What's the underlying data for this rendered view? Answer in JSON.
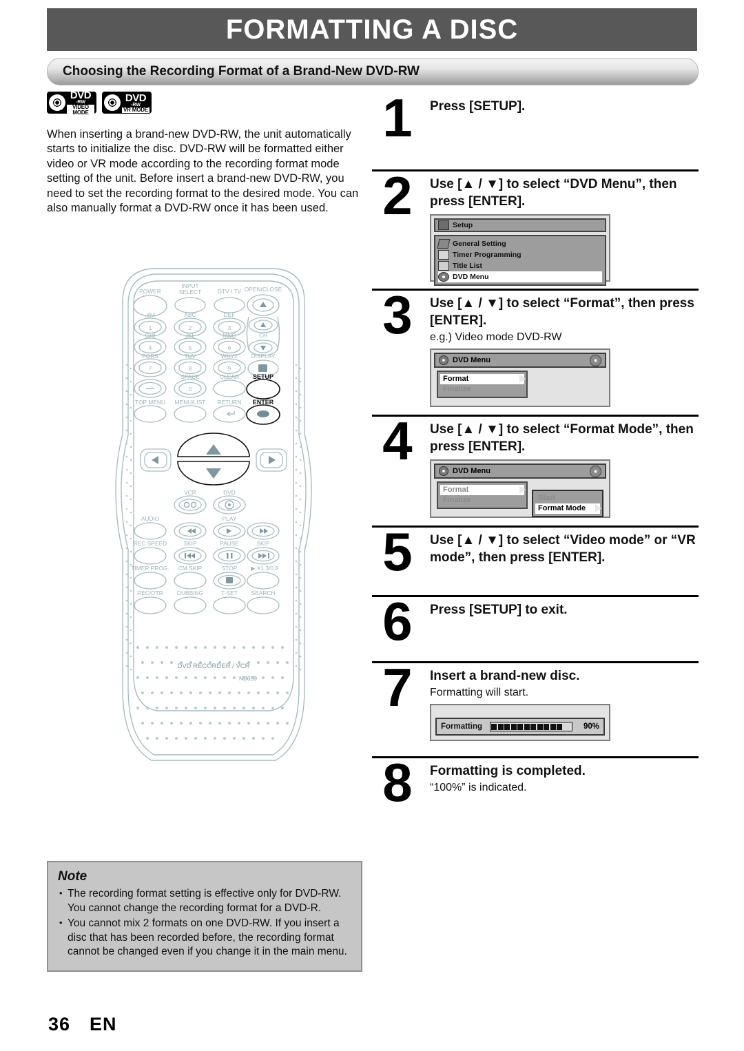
{
  "header": {
    "title": "FORMATTING A DISC",
    "subtitle": "Choosing the Recording Format of a Brand-New DVD-RW"
  },
  "logos": [
    {
      "name": "dvd-rw-video-mode-logo",
      "line1": "DVD",
      "line2": "-RW",
      "line3": "VIDEO MODE"
    },
    {
      "name": "dvd-rw-vr-mode-logo",
      "line1": "DVD",
      "line2": "-RW",
      "line3": "VR MODE"
    }
  ],
  "intro": "When inserting a brand-new DVD-RW, the unit automatically starts to initialize the disc. DVD-RW will be formatted either video or VR mode according to the recording format mode setting of the unit. Before insert a brand-new DVD-RW, you need to set the recording format to the desired mode. You can also manually format a DVD-RW once it has been used.",
  "steps": [
    {
      "number": "1",
      "heading": "Press [SETUP].",
      "sub": ""
    },
    {
      "number": "2",
      "heading": "Use [▲ / ▼] to select “DVD Menu”, then press [ENTER].",
      "sub": ""
    },
    {
      "number": "3",
      "heading": "Use [▲ / ▼] to select “Format”, then press [ENTER].",
      "sub": "e.g.) Video mode DVD-RW"
    },
    {
      "number": "4",
      "heading": "Use [▲ / ▼] to select “Format Mode”, then press [ENTER].",
      "sub": ""
    },
    {
      "number": "5",
      "heading": "Use [▲ / ▼] to select “Video mode” or “VR mode”, then press [ENTER].",
      "sub": ""
    },
    {
      "number": "6",
      "heading": "Press [SETUP] to exit.",
      "sub": ""
    },
    {
      "number": "7",
      "heading": "Insert a brand-new disc.",
      "sub": "Formatting will start."
    },
    {
      "number": "8",
      "heading": "Formatting is completed.",
      "sub": "“100%” is indicated."
    }
  ],
  "osd_setup": {
    "title": "Setup",
    "items": [
      {
        "label": "General Setting",
        "selected": false,
        "icon": "wrench-icon"
      },
      {
        "label": "Timer Programming",
        "selected": false,
        "icon": "grid-icon"
      },
      {
        "label": "Title List",
        "selected": false,
        "icon": "list-icon"
      },
      {
        "label": "DVD Menu",
        "selected": true,
        "icon": "disc-icon"
      }
    ]
  },
  "osd_dvdmenu_step3": {
    "title": "DVD Menu",
    "items": [
      {
        "label": "Format",
        "selected": true
      },
      {
        "label": "Finalize",
        "selected": false
      }
    ]
  },
  "osd_dvdmenu_step4": {
    "title": "DVD Menu",
    "items": [
      {
        "label": "Format",
        "selected": false
      },
      {
        "label": "Finalize",
        "selected": false
      }
    ],
    "submenu": [
      {
        "label": "Start",
        "selected": false
      },
      {
        "label": "Format Mode",
        "selected": true
      }
    ]
  },
  "osd_formatting": {
    "label": "Formatting",
    "percent": "90%",
    "segments": 11
  },
  "note": {
    "title": "Note",
    "items": [
      "The recording format setting is effective only for DVD-RW. You cannot change the recording format for a DVD-R.",
      "You cannot mix 2 formats on one DVD-RW. If you insert a disc that has been recorded before, the recording format cannot be changed even if you change it in the main menu."
    ]
  },
  "remote": {
    "model_label": "DVD RECORDER / VCR",
    "model_number": "NB659",
    "labels": {
      "power": "POWER",
      "input_select": "INPUT\nSELECT",
      "dtv_tv": "DTV / TV",
      "open_close": "OPEN/CLOSE",
      "k1_sup": ".@/:",
      "k2_sup": "ABC",
      "k3_sup": "DEF",
      "k4_sup": "GHI",
      "k5_sup": "JKL",
      "k6_sup": "MNO",
      "k7_sup": "PQRS",
      "k8_sup": "TUV",
      "k9_sup": "WXYZ",
      "k0_sup": "SPACE",
      "clear": "CLEAR",
      "display": "DISPLAY",
      "ch": "CH",
      "setup": "SETUP",
      "enter": "ENTER",
      "top_menu": "TOP MENU",
      "menu_list": "MENU/LIST",
      "return": "RETURN",
      "vcr": "VCR",
      "dvd": "DVD",
      "audio": "AUDIO",
      "play": "PLAY",
      "rec_speed": "REC SPEED",
      "skip_left": "SKIP",
      "pause": "PAUSE",
      "skip_right": "SKIP",
      "timer_prog": "TIMER PROG.",
      "cm_skip": "CM SKIP",
      "stop": "STOP",
      "speed": "▶ X1.3/0.8",
      "rec_otr": "REC/OTR",
      "dubbing": "DUBBING",
      "t_set": "T-SET",
      "search": "SEARCH",
      "n1": "1",
      "n2": "2",
      "n3": "3",
      "n4": "4",
      "n5": "5",
      "n6": "6",
      "n7": "7",
      "n8": "8",
      "n9": "9",
      "n0": "0"
    }
  },
  "footer": {
    "page": "36",
    "lang": "EN"
  },
  "colors": {
    "header_bg": "#585858",
    "note_bg": "#c6c6c6",
    "osd_bg": "#9d9d9d",
    "remote_outline": "#a9bcc0"
  }
}
